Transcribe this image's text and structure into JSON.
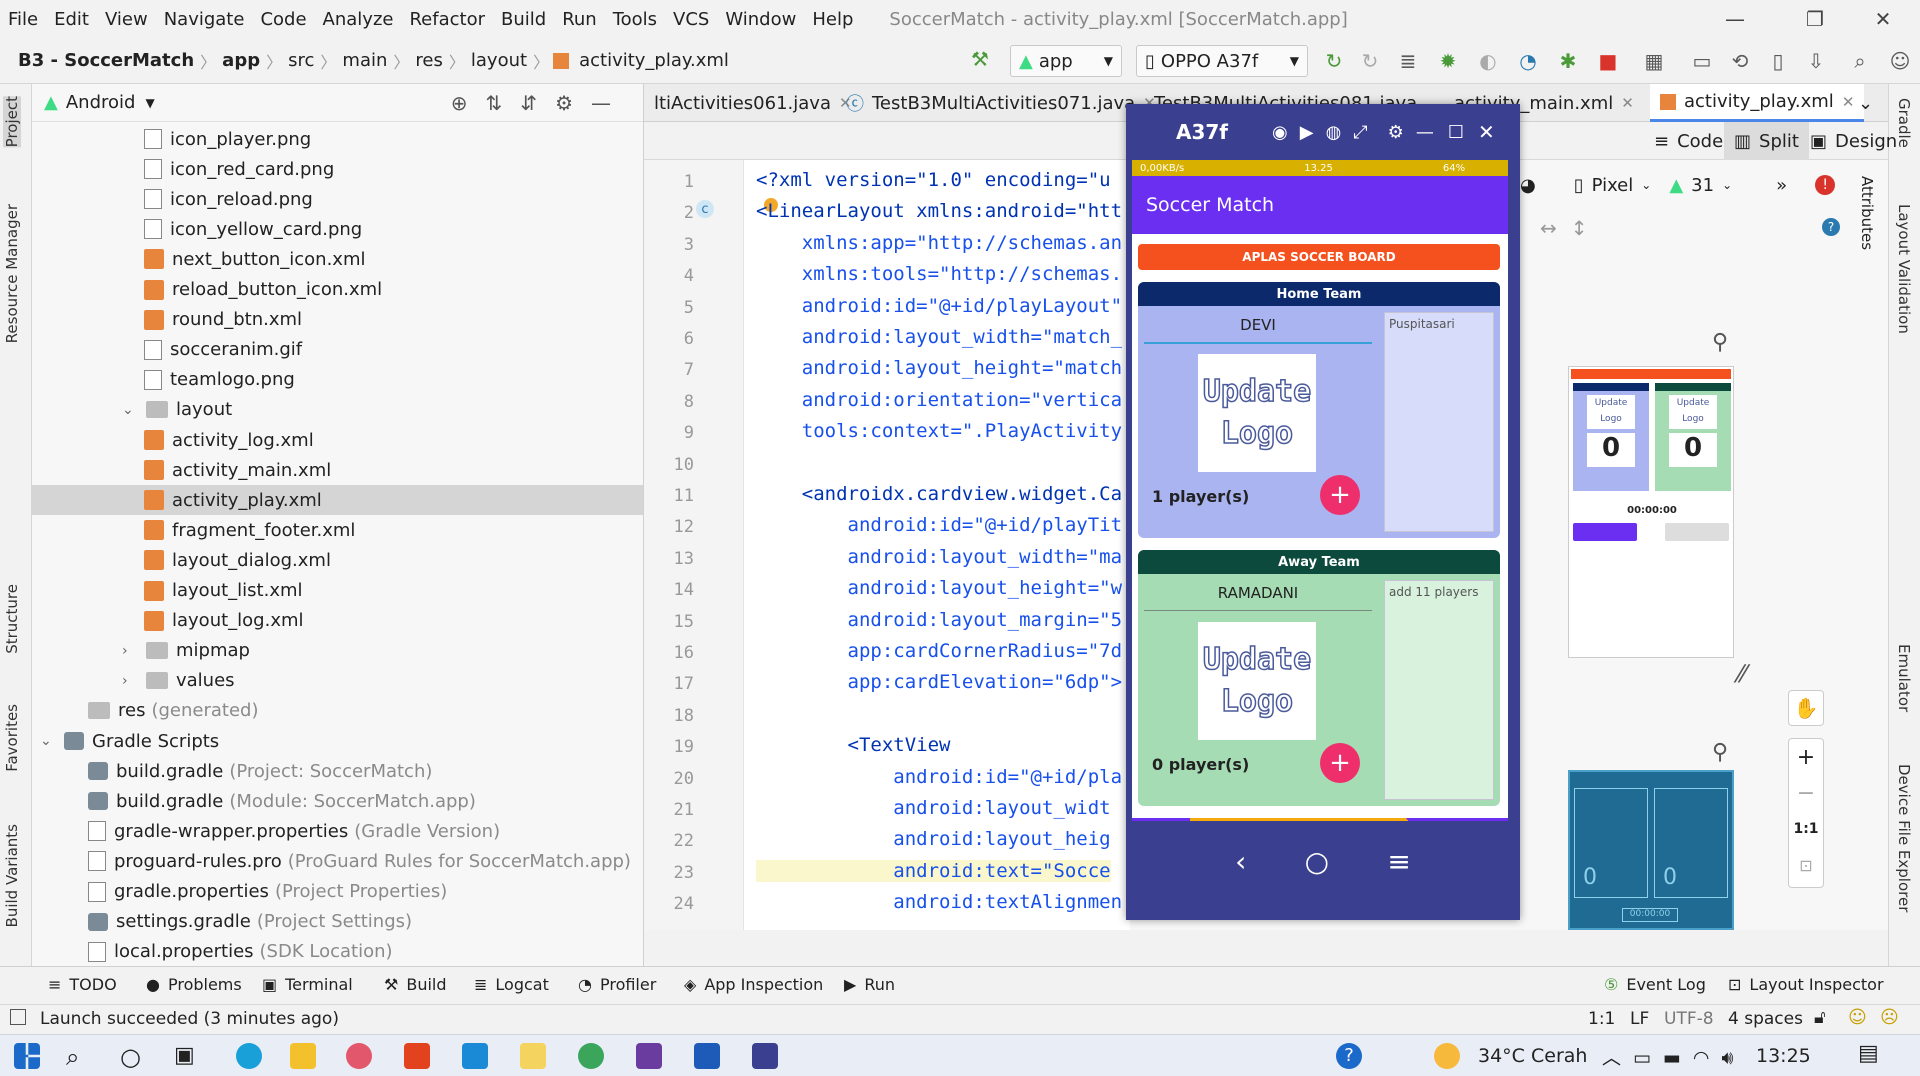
{
  "menu": {
    "items": [
      "File",
      "Edit",
      "View",
      "Navigate",
      "Code",
      "Analyze",
      "Refactor",
      "Build",
      "Run",
      "Tools",
      "VCS",
      "Window",
      "Help"
    ],
    "window_title": "SoccerMatch - activity_play.xml [SoccerMatch.app]"
  },
  "breadcrumb": [
    "B3 - SoccerMatch",
    "app",
    "src",
    "main",
    "res",
    "layout",
    "activity_play.xml"
  ],
  "toolbar": {
    "config": "app",
    "device": "OPPO A37f"
  },
  "project": {
    "view": "Android",
    "items": [
      {
        "label": "icon_player.png",
        "type": "png",
        "level": 3
      },
      {
        "label": "icon_red_card.png",
        "type": "png",
        "level": 3
      },
      {
        "label": "icon_reload.png",
        "type": "png",
        "level": 3
      },
      {
        "label": "icon_yellow_card.png",
        "type": "png",
        "level": 3
      },
      {
        "label": "next_button_icon.xml",
        "type": "xml",
        "level": 3
      },
      {
        "label": "reload_button_icon.xml",
        "type": "xml",
        "level": 3
      },
      {
        "label": "round_btn.xml",
        "type": "xml",
        "level": 3
      },
      {
        "label": "socceranim.gif",
        "type": "png",
        "level": 3
      },
      {
        "label": "teamlogo.png",
        "type": "png",
        "level": 3
      },
      {
        "label": "layout",
        "type": "folder-open",
        "level": 2
      },
      {
        "label": "activity_log.xml",
        "type": "xml",
        "level": 3
      },
      {
        "label": "activity_main.xml",
        "type": "xml",
        "level": 3
      },
      {
        "label": "activity_play.xml",
        "type": "xml",
        "level": 3
      },
      {
        "label": "fragment_footer.xml",
        "type": "xml",
        "level": 3
      },
      {
        "label": "layout_dialog.xml",
        "type": "xml",
        "level": 3
      },
      {
        "label": "layout_list.xml",
        "type": "xml",
        "level": 3
      },
      {
        "label": "layout_log.xml",
        "type": "xml",
        "level": 3
      },
      {
        "label": "mipmap",
        "type": "folder",
        "level": 2
      },
      {
        "label": "values",
        "type": "folder",
        "level": 2
      },
      {
        "label": "res",
        "type": "res",
        "level": 1,
        "note": "(generated)"
      },
      {
        "label": "Gradle Scripts",
        "type": "gradle-root",
        "level": 0
      },
      {
        "label": "build.gradle",
        "type": "gradle",
        "level": 1,
        "note": "(Project: SoccerMatch)"
      },
      {
        "label": "build.gradle",
        "type": "gradle",
        "level": 1,
        "note": "(Module: SoccerMatch.app)"
      },
      {
        "label": "gradle-wrapper.properties",
        "type": "props",
        "level": 1,
        "note": "(Gradle Version)"
      },
      {
        "label": "proguard-rules.pro",
        "type": "props",
        "level": 1,
        "note": "(ProGuard Rules for SoccerMatch.app)"
      },
      {
        "label": "gradle.properties",
        "type": "props",
        "level": 1,
        "note": "(Project Properties)"
      },
      {
        "label": "settings.gradle",
        "type": "gradle",
        "level": 1,
        "note": "(Project Settings)"
      },
      {
        "label": "local.properties",
        "type": "props",
        "level": 1,
        "note": "(SDK Location)"
      }
    ]
  },
  "tabs": [
    "ltiActivities061.java",
    "TestB3MultiActivities071.java",
    "TestB3MultiActivities081.java",
    "activity_main.xml",
    "activity_play.xml"
  ],
  "editor_modes": [
    "Code",
    "Split",
    "Design"
  ],
  "design_toolbar": {
    "device": "Pixel",
    "api": "31"
  },
  "code_lines": [
    {
      "n": "1",
      "text": "<?xml version=\"1.0\" encoding=\"u"
    },
    {
      "n": "2",
      "text": "<LinearLayout xmlns:android=\"htt"
    },
    {
      "n": "3",
      "text": "    xmlns:app=\"http://schemas.an"
    },
    {
      "n": "4",
      "text": "    xmlns:tools=\"http://schemas."
    },
    {
      "n": "5",
      "text": "    android:id=\"@+id/playLayout\""
    },
    {
      "n": "6",
      "text": "    android:layout_width=\"match_"
    },
    {
      "n": "7",
      "text": "    android:layout_height=\"match"
    },
    {
      "n": "8",
      "text": "    android:orientation=\"vertica"
    },
    {
      "n": "9",
      "text": "    tools:context=\".PlayActivity"
    },
    {
      "n": "10",
      "text": ""
    },
    {
      "n": "11",
      "text": "    <androidx.cardview.widget.Ca"
    },
    {
      "n": "12",
      "text": "        android:id=\"@+id/playTit"
    },
    {
      "n": "13",
      "text": "        android:layout_width=\"ma"
    },
    {
      "n": "14",
      "text": "        android:layout_height=\"w"
    },
    {
      "n": "15",
      "text": "        android:layout_margin=\"5"
    },
    {
      "n": "16",
      "text": "        app:cardCornerRadius=\"7d"
    },
    {
      "n": "17",
      "text": "        app:cardElevation=\"6dp\">"
    },
    {
      "n": "18",
      "text": ""
    },
    {
      "n": "19",
      "text": "        <TextView"
    },
    {
      "n": "20",
      "text": "            android:id=\"@+id/pla"
    },
    {
      "n": "21",
      "text": "            android:layout_widt"
    },
    {
      "n": "22",
      "text": "            android:layout_heig"
    },
    {
      "n": "23",
      "text": "            android:text=\"Socce"
    },
    {
      "n": "24",
      "text": "            android:textAlignmen"
    }
  ],
  "emulator": {
    "title": "A37f",
    "status_text": "0,00KB/s",
    "status_time": "13.25",
    "status_battery": "64%",
    "app_title": "Soccer Match",
    "board_label": "APLAS SOCCER BOARD",
    "home": {
      "header": "Home Team",
      "team_name": "DEVI",
      "logo": [
        "Update",
        "Logo"
      ],
      "count": "1 player(s)",
      "list_item": "Puspitasari"
    },
    "away": {
      "header": "Away Team",
      "team_name": "RAMADANI",
      "logo": [
        "Update",
        "Logo"
      ],
      "count": "0 player(s)",
      "list_item": "add 11 players"
    }
  },
  "preview": {
    "score_home": "0",
    "score_away": "0",
    "timer": "00:00:00",
    "logo_lines": [
      "Update",
      "Logo"
    ],
    "blueprint_home": "0",
    "blueprint_away": "0",
    "blueprint_timer": "00:00:00"
  },
  "zoom_label": "1:1",
  "bottom_tools": [
    "TODO",
    "Problems",
    "Terminal",
    "Build",
    "Logcat",
    "Profiler",
    "App Inspection",
    "Run",
    "Event Log",
    "Layout Inspector"
  ],
  "status": {
    "message": "Launch succeeded (3 minutes ago)",
    "pos": "1:1",
    "eol": "LF",
    "enc": "UTF-8",
    "indent": "4 spaces"
  },
  "left_tabs": [
    "Project",
    "Resource Manager",
    "Structure",
    "Favorites",
    "Build Variants"
  ],
  "right_tabs": [
    "Gradle",
    "Layout Validation",
    "Attributes",
    "Emulator",
    "Device File Explorer"
  ],
  "taskbar": {
    "weather": "34°C Cerah",
    "time": "13:25"
  },
  "colors": {
    "accent": "#4a86e8",
    "app_bar": "#6a2ff0",
    "board": "#f4511e",
    "home_card": "#a9b4f0",
    "away_card": "#a6dcb4",
    "fab": "#ef2f6b"
  }
}
